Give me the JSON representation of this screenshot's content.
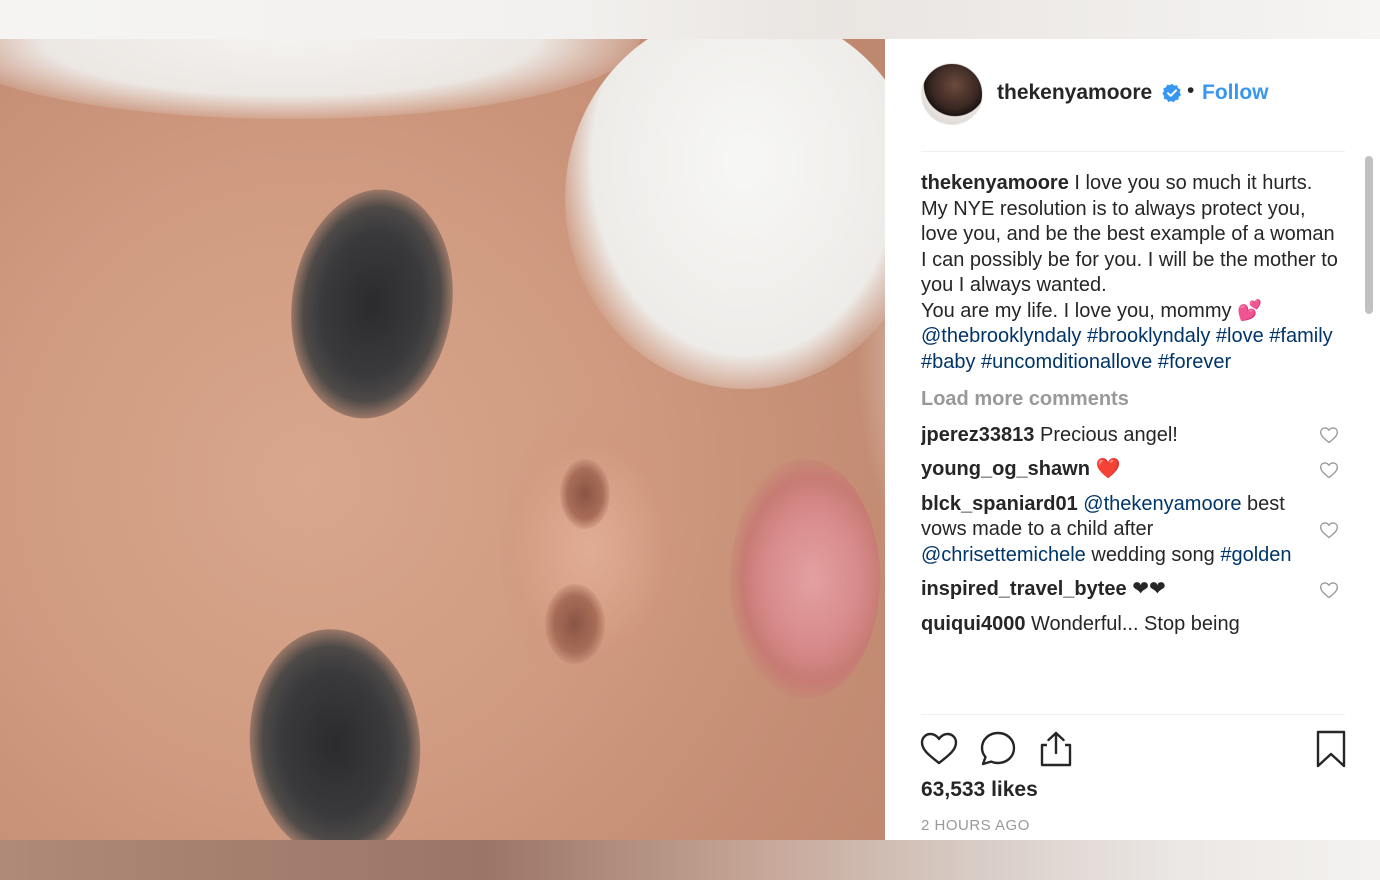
{
  "post": {
    "username": "thekenyamoore",
    "separator": "•",
    "follow_label": "Follow",
    "caption": {
      "username": "thekenyamoore",
      "text": " I love you so much it hurts. My NYE resolution is to always protect you, love you, and be the best example of a woman I can possibly be for you. I will be the mother to you I always wanted.",
      "line2": "You are my life. I love you, mommy 💕",
      "tags": "@thebrooklyndaly #brooklyndaly #love #family #baby #uncomditionallove #forever"
    },
    "load_more": "Load more comments",
    "comments": [
      {
        "user": "jperez33813",
        "text": " Precious angel!"
      },
      {
        "user": "young_og_shawn",
        "text": " ❤️"
      },
      {
        "user": "blck_spaniard01",
        "mention1": " @thekenyamoore",
        "text1": " best vows made to a child after ",
        "mention2": "@chrisettemichele",
        "text2": " wedding song ",
        "tag": "#golden"
      },
      {
        "user": "inspired_travel_bytee",
        "text": " ❤❤"
      },
      {
        "user": "quiqui4000",
        "text": " Wonderful... Stop being"
      }
    ],
    "likes": "63,533 likes",
    "timestamp": "2 HOURS AGO"
  },
  "colors": {
    "link": "#3897f0",
    "tag": "#003569",
    "text": "#262626",
    "muted": "#999999"
  },
  "icons": [
    "verified-badge-icon",
    "heart-icon",
    "comment-bubble-icon",
    "share-icon",
    "bookmark-icon"
  ]
}
